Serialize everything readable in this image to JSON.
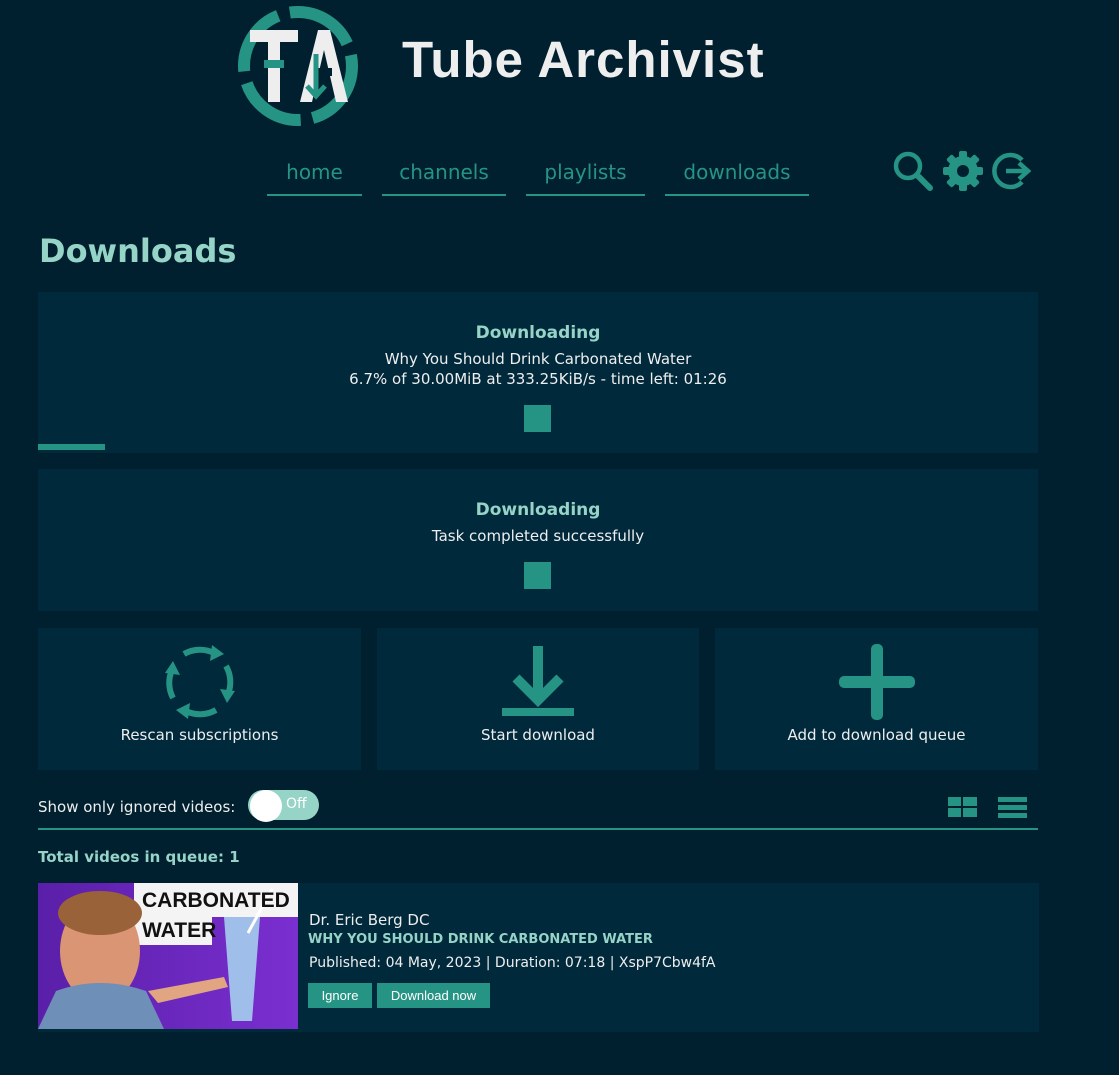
{
  "header": {
    "logo_text": "Tube Archivist",
    "logo_icon": "tube-archivist-logo"
  },
  "nav": {
    "items": [
      {
        "label": "home"
      },
      {
        "label": "channels"
      },
      {
        "label": "playlists"
      },
      {
        "label": "downloads"
      }
    ],
    "icons": [
      "search-icon",
      "gear-icon",
      "logout-icon"
    ]
  },
  "page": {
    "title": "Downloads"
  },
  "notifications": [
    {
      "title": "Downloading",
      "lines": [
        "Why You Should Drink Carbonated Water",
        "6.7% of 30.00MiB at 333.25KiB/s - time left: 01:26"
      ],
      "progress_percent": 6.7
    },
    {
      "title": "Downloading",
      "lines": [
        "Task completed successfully"
      ]
    }
  ],
  "actions": [
    {
      "label": "Rescan subscriptions",
      "icon": "rescan-icon"
    },
    {
      "label": "Start download",
      "icon": "download-icon"
    },
    {
      "label": "Add to download queue",
      "icon": "add-icon"
    }
  ],
  "filter": {
    "label": "Show only ignored videos:",
    "toggle_state": "Off"
  },
  "view_icons": [
    "grid-view-icon",
    "list-view-icon"
  ],
  "queue": {
    "total_label": "Total videos in queue: 1",
    "videos": [
      {
        "channel": "Dr. Eric Berg DC",
        "title": "WHY YOU SHOULD DRINK CARBONATED WATER",
        "meta": "Published: 04 May, 2023 | Duration: 07:18 | XspP7Cbw4fA",
        "thumb_text_1": "CARBONATED",
        "thumb_text_2": "WATER",
        "ignore_label": "Ignore",
        "download_label": "Download now"
      }
    ]
  },
  "colors": {
    "background": "#00202f",
    "panel": "#00293b",
    "accent": "#259485",
    "accent_light": "#97d4c8"
  }
}
